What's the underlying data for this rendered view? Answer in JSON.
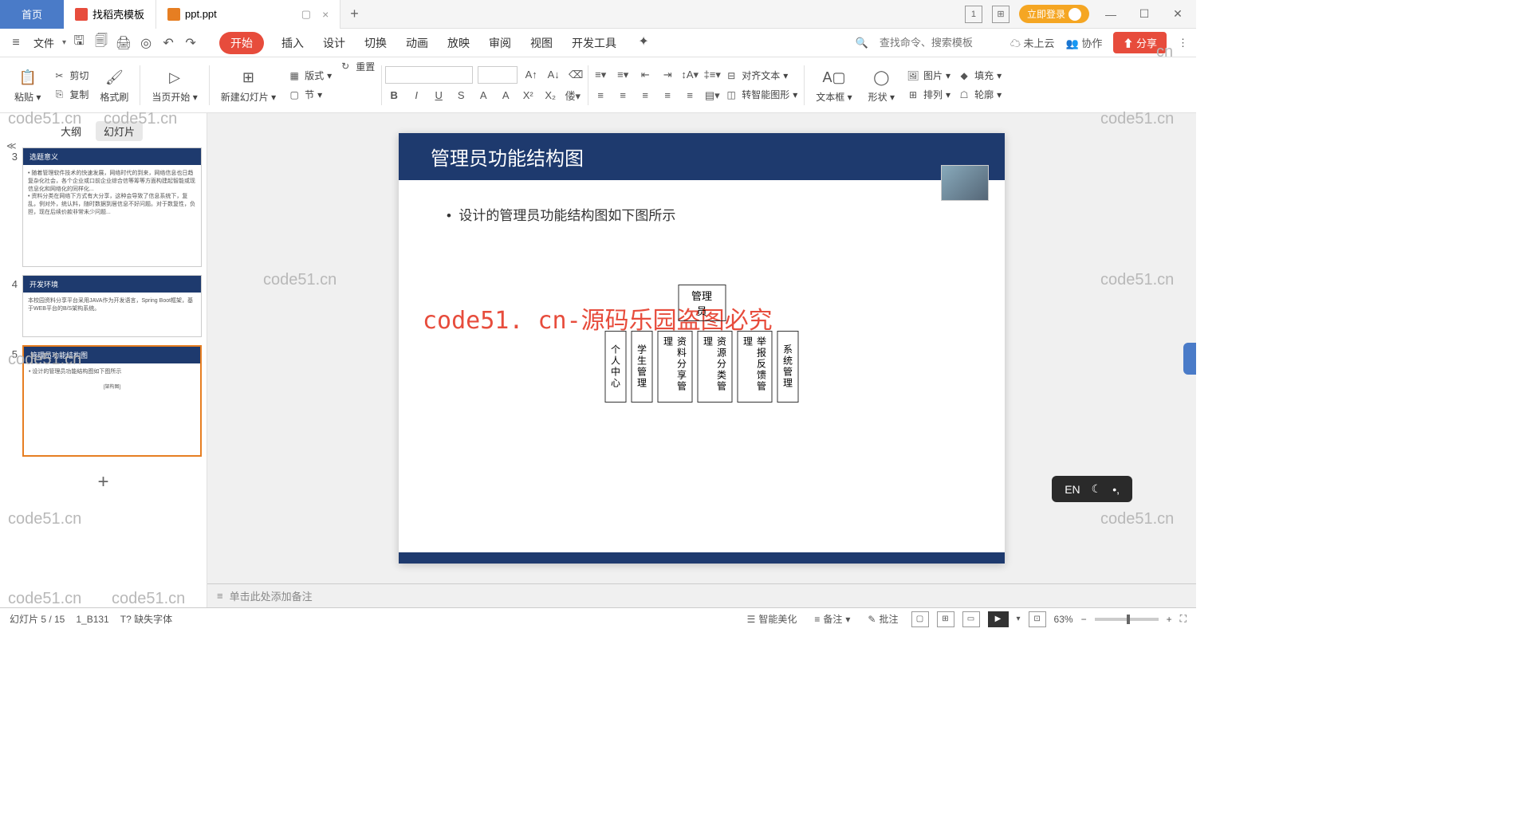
{
  "tabs": {
    "home": "首页",
    "template": "找稻壳模板",
    "doc": "ppt.ppt"
  },
  "titlebar": {
    "login": "立即登录"
  },
  "menu": {
    "file": "文件",
    "start": "开始",
    "insert": "插入",
    "design": "设计",
    "transition": "切换",
    "animation": "动画",
    "slideshow": "放映",
    "review": "审阅",
    "view": "视图",
    "dev": "开发工具"
  },
  "menuRight": {
    "search": "查找命令、搜索模板",
    "cloud": "未上云",
    "collab": "协作",
    "share": "分享"
  },
  "ribbon": {
    "paste": "粘贴",
    "cut": "剪切",
    "copy": "复制",
    "format": "格式刷",
    "thispage": "当页开始",
    "newslide": "新建幻灯片",
    "layout": "版式",
    "reset": "重置",
    "section": "节",
    "alignText": "对齐文本",
    "convertShape": "转智能图形",
    "textbox": "文本框",
    "shape": "形状",
    "image": "图片",
    "arrange": "排列",
    "fill": "填充",
    "outline": "轮廓"
  },
  "thumbs": {
    "outline": "大纲",
    "slides": "幻灯片",
    "t3": "选题意义",
    "t4": "开发环境",
    "t4body": "本校园资料分享平台采用JAVA作为开发语言，Spring Boot框架，基于WEB平台的B/S架构系统。",
    "t5": "管理员功能结构图"
  },
  "slide": {
    "title": "管理员功能结构图",
    "bullet": "设计的管理员功能结构图如下图所示",
    "watermark": "code51. cn-源码乐园盗图必究",
    "root": "管理员",
    "children": [
      "个人中心",
      "学生管理",
      "资料分享管理",
      "资源分类管理",
      "举报反馈管理",
      "系统管理"
    ]
  },
  "notes": {
    "placeholder": "单击此处添加备注"
  },
  "status": {
    "pos": "幻灯片 5 / 15",
    "theme": "1_B131",
    "missingFont": "缺失字体",
    "beautify": "智能美化",
    "notes": "备注",
    "comment": "批注",
    "zoom": "63%"
  },
  "ime": {
    "lang": "EN"
  },
  "wm": "code51.cn"
}
